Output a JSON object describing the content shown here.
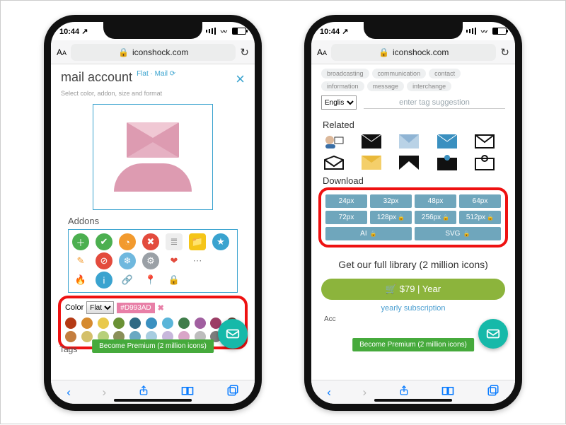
{
  "status": {
    "time": "10:44",
    "loc_glyph": "↗"
  },
  "address": {
    "lock": "🔒",
    "host": "iconshock.com",
    "reload": "↻"
  },
  "left": {
    "title": "mail account",
    "chip": "Flat · Mail ⟳",
    "subtitle": "Select color, addon, size and format",
    "addons_label": "Addons",
    "color_label": "Color",
    "color_select": "Flat",
    "hex": "#D993AD",
    "palette": [
      "#b53a15",
      "#d68a2e",
      "#e9c94b",
      "#6a9135",
      "#2f6a84",
      "#3a90c0",
      "#5ab5d9",
      "#3f7d4a",
      "#a15fa0",
      "#9c3e66",
      "#5e4637",
      "#c47e3f",
      "#d4c06a",
      "#b7d07a",
      "#8a8f58",
      "#6aa8c2",
      "#a7cde0",
      "#c7b7db",
      "#d9a6c8",
      "#bdbdbd",
      "#7d7d7d",
      "#3a3a3a"
    ],
    "tags_label": "Tags",
    "cta": "Become Premium (2 million icons)"
  },
  "right": {
    "tag_chips": [
      "broadcasting",
      "communication",
      "contact",
      "information",
      "message",
      "interchange"
    ],
    "lang": "Englis",
    "tag_placeholder": "enter tag suggestion",
    "related_label": "Related",
    "download_label": "Download",
    "sizes": [
      "24px",
      "32px",
      "48px",
      "64px",
      "72px",
      "128px",
      "256px",
      "512px"
    ],
    "vectors": [
      "AI",
      "SVG"
    ],
    "full_library": "Get our full library (2 million icons)",
    "buy_label": "$79 | Year",
    "yearly": "yearly subscription",
    "acc": "Acc",
    "cta": "Become Premium (2 million icons)"
  },
  "nav": {
    "back": "‹",
    "fwd": "›",
    "share": "⇪",
    "book": "▭▭",
    "tabs": "❐"
  }
}
